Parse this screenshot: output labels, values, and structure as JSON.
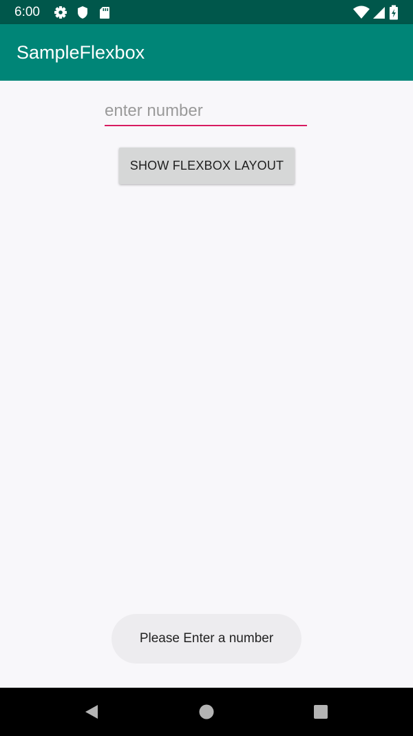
{
  "status_bar": {
    "time": "6:00",
    "left_icons": [
      "gear-icon",
      "shield-icon",
      "sd-card-icon"
    ],
    "right_icons": [
      "wifi-icon",
      "signal-icon",
      "battery-icon"
    ],
    "background": "#00574b"
  },
  "app_bar": {
    "title": "SampleFlexbox",
    "background": "#008577"
  },
  "form": {
    "number_input": {
      "value": "",
      "placeholder": "enter number",
      "underline_color": "#d81b60"
    },
    "show_button_label": "SHOW FLEXBOX LAYOUT"
  },
  "toast": {
    "message": "Please Enter a number"
  },
  "nav_bar": {
    "buttons": [
      "back-icon",
      "home-icon",
      "recents-icon"
    ]
  }
}
